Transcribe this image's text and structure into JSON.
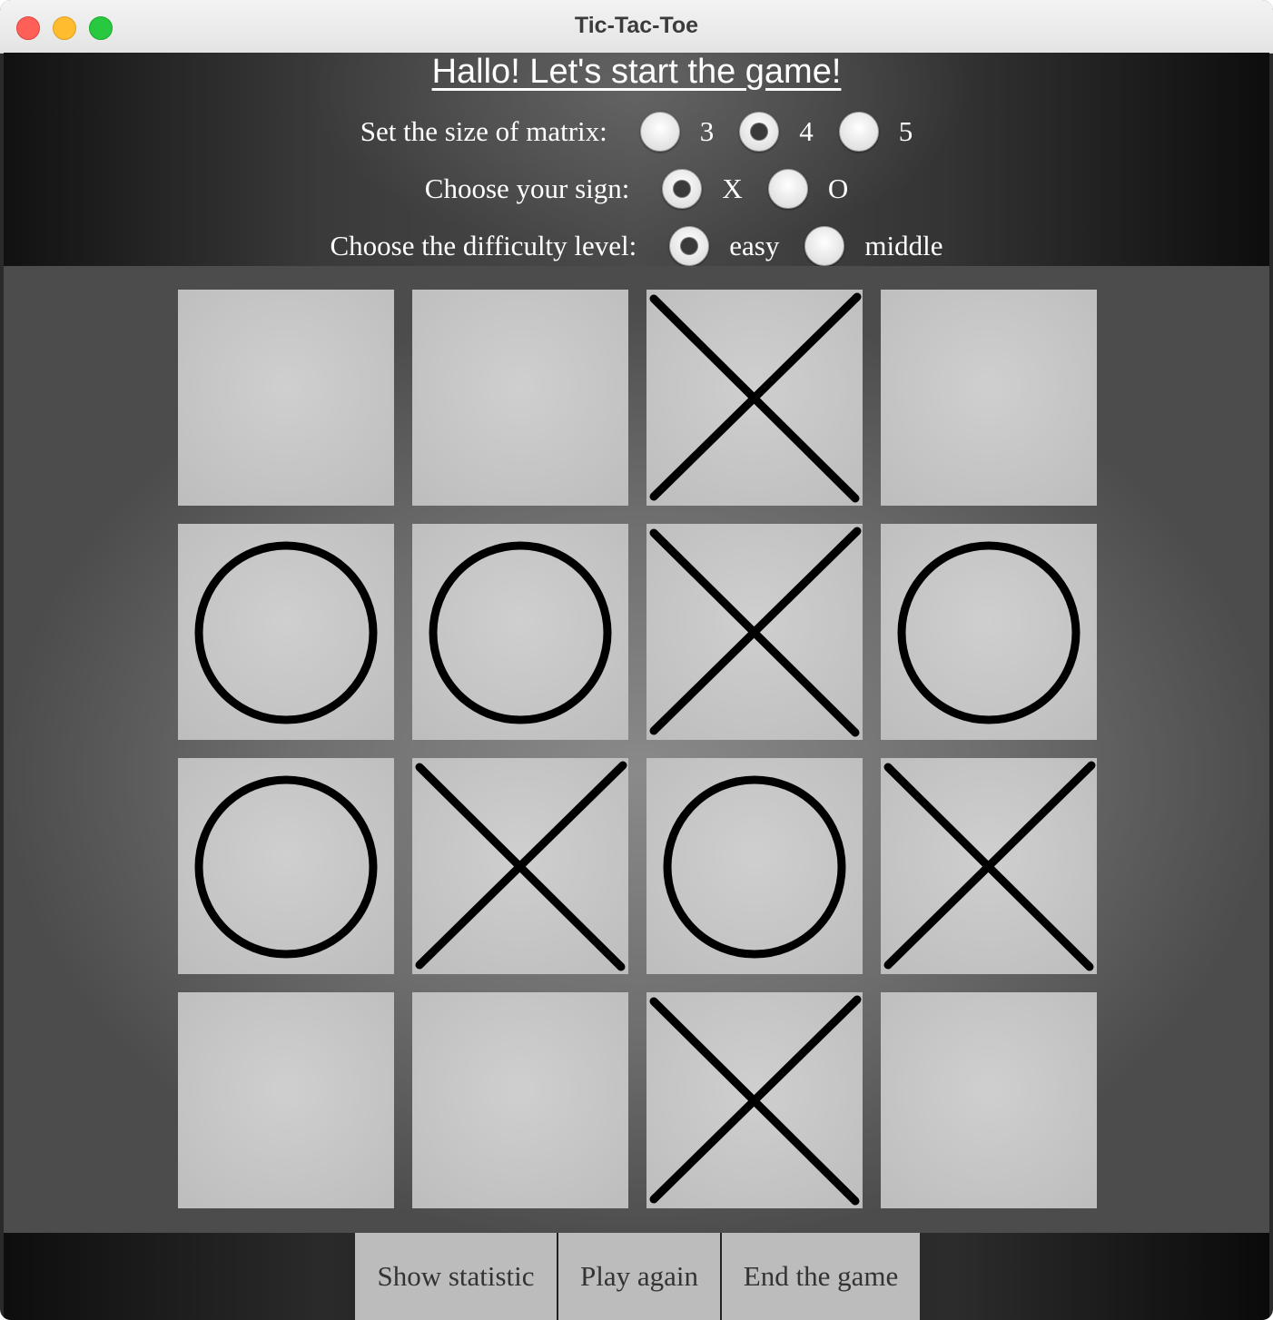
{
  "window": {
    "title": "Tic-Tac-Toe"
  },
  "header": {
    "heading": "Hallo! Let's start the game!",
    "matrix": {
      "label": "Set the size of matrix:",
      "options": [
        "3",
        "4",
        "5"
      ],
      "selected": "4"
    },
    "sign": {
      "label": "Choose your sign:",
      "options": [
        "X",
        "O"
      ],
      "selected": "X"
    },
    "difficulty": {
      "label": "Choose the difficulty level:",
      "options": [
        "easy",
        "middle"
      ],
      "selected": "easy"
    }
  },
  "board": {
    "size": 4,
    "cells": [
      [
        "",
        "",
        "X",
        ""
      ],
      [
        "O",
        "O",
        "X",
        "O"
      ],
      [
        "O",
        "X",
        "O",
        "X"
      ],
      [
        "",
        "",
        "X",
        ""
      ]
    ]
  },
  "buttons": {
    "statistic": "Show statistic",
    "play_again": "Play again",
    "end": "End the game"
  }
}
